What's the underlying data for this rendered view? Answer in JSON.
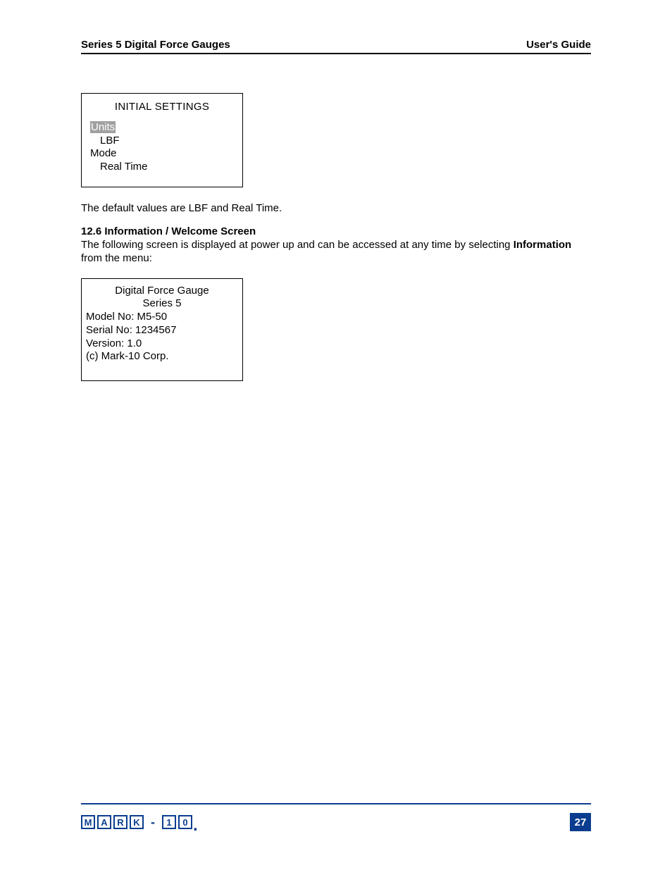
{
  "header": {
    "left": "Series 5 Digital Force Gauges",
    "right": "User's Guide"
  },
  "screen1": {
    "title": "INITIAL SETTINGS",
    "unitsLabel": "Units",
    "unitsValue": "LBF",
    "modeLabel": "Mode",
    "modeValue": "Real Time"
  },
  "paragraphs": {
    "defaults": "The default values are LBF and Real Time.",
    "sectionNum": "12.6 Information / Welcome Screen",
    "infoPara1": "The following screen is displayed at power up and can be accessed at any time by selecting ",
    "infoBold": "Information",
    "infoPara2": "from the menu:"
  },
  "screen2": {
    "line1": "Digital Force Gauge",
    "line2": "Series 5",
    "model": "Model No: M5-50",
    "serial": "Serial No: 1234567",
    "version": "Version: 1.0",
    "copyright": "(c) Mark-10 Corp."
  },
  "footer": {
    "logoLetters": [
      "M",
      "A",
      "R",
      "K",
      "-",
      "1",
      "0"
    ],
    "pageNum": "27"
  }
}
